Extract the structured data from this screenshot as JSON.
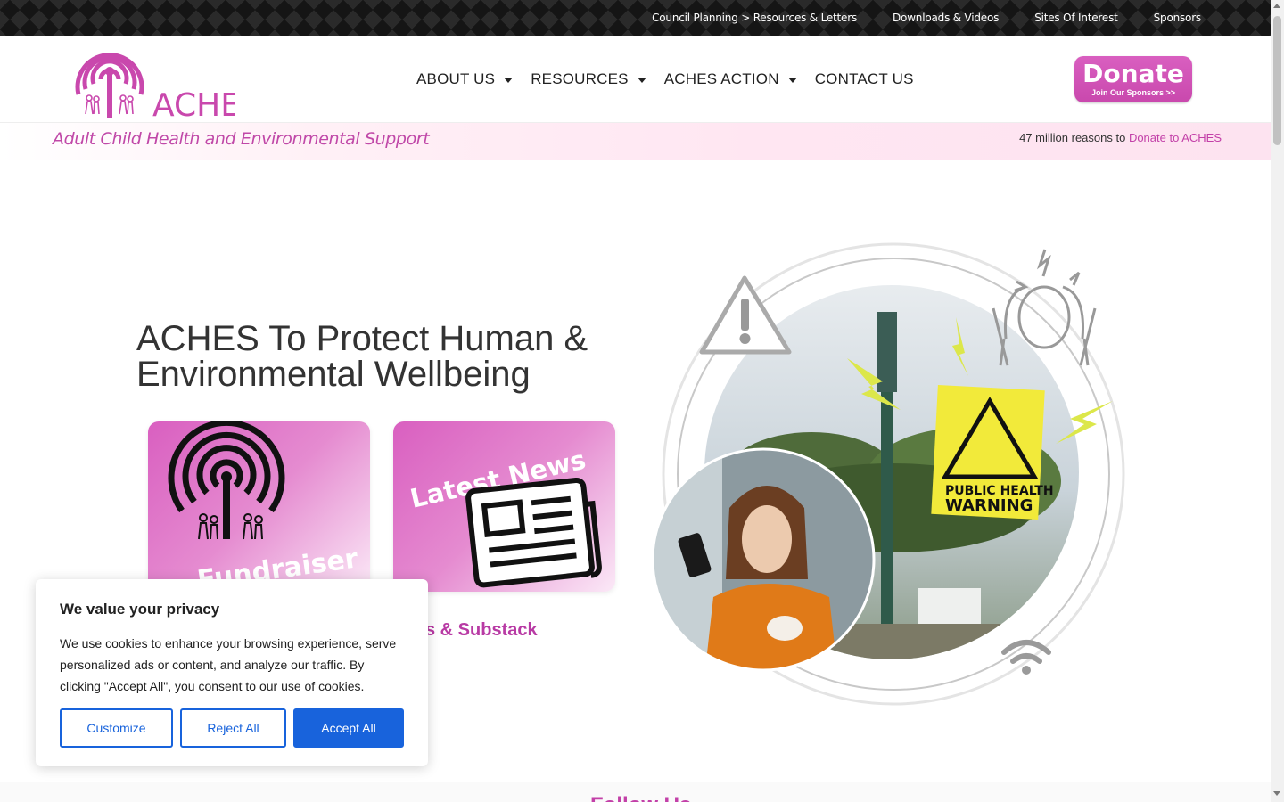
{
  "topnav": {
    "items": [
      "Council Planning > Resources & Letters",
      "Downloads & Videos",
      "Sites Of Interest",
      "Sponsors"
    ]
  },
  "header": {
    "logo_text": "ACHES",
    "nav": [
      {
        "label": "ABOUT US",
        "has_dropdown": true
      },
      {
        "label": "RESOURCES",
        "has_dropdown": true
      },
      {
        "label": "ACHES ACTION",
        "has_dropdown": true
      },
      {
        "label": "CONTACT US",
        "has_dropdown": false
      }
    ],
    "donate": {
      "label": "Donate",
      "sublabel": "Join Our Sponsors >>"
    }
  },
  "tagstrip": {
    "tagline": "Adult Child Health and Environmental Support",
    "reasons_prefix": "47 million reasons to ",
    "reasons_link": "Donate to ACHES"
  },
  "hero": {
    "title": "ACHES To Protect Human & Environmental Wellbeing",
    "card1_label": "Fundraiser",
    "card2_label": "Latest News",
    "card2_link": "s & Substack",
    "illustration_sign": [
      "PUBLIC HEALTH",
      "WARNING"
    ]
  },
  "follow": {
    "title": "Follow Us"
  },
  "cookie": {
    "title": "We value your privacy",
    "body": "We use cookies to enhance your browsing experience, serve personalized ads or content, and analyze our traffic. By clicking \"Accept All\", you consent to our use of cookies.",
    "customize": "Customize",
    "reject": "Reject All",
    "accept": "Accept All"
  },
  "colors": {
    "brand": "#c948ad",
    "accent_blue": "#1863dc",
    "topbar": "#151515"
  }
}
